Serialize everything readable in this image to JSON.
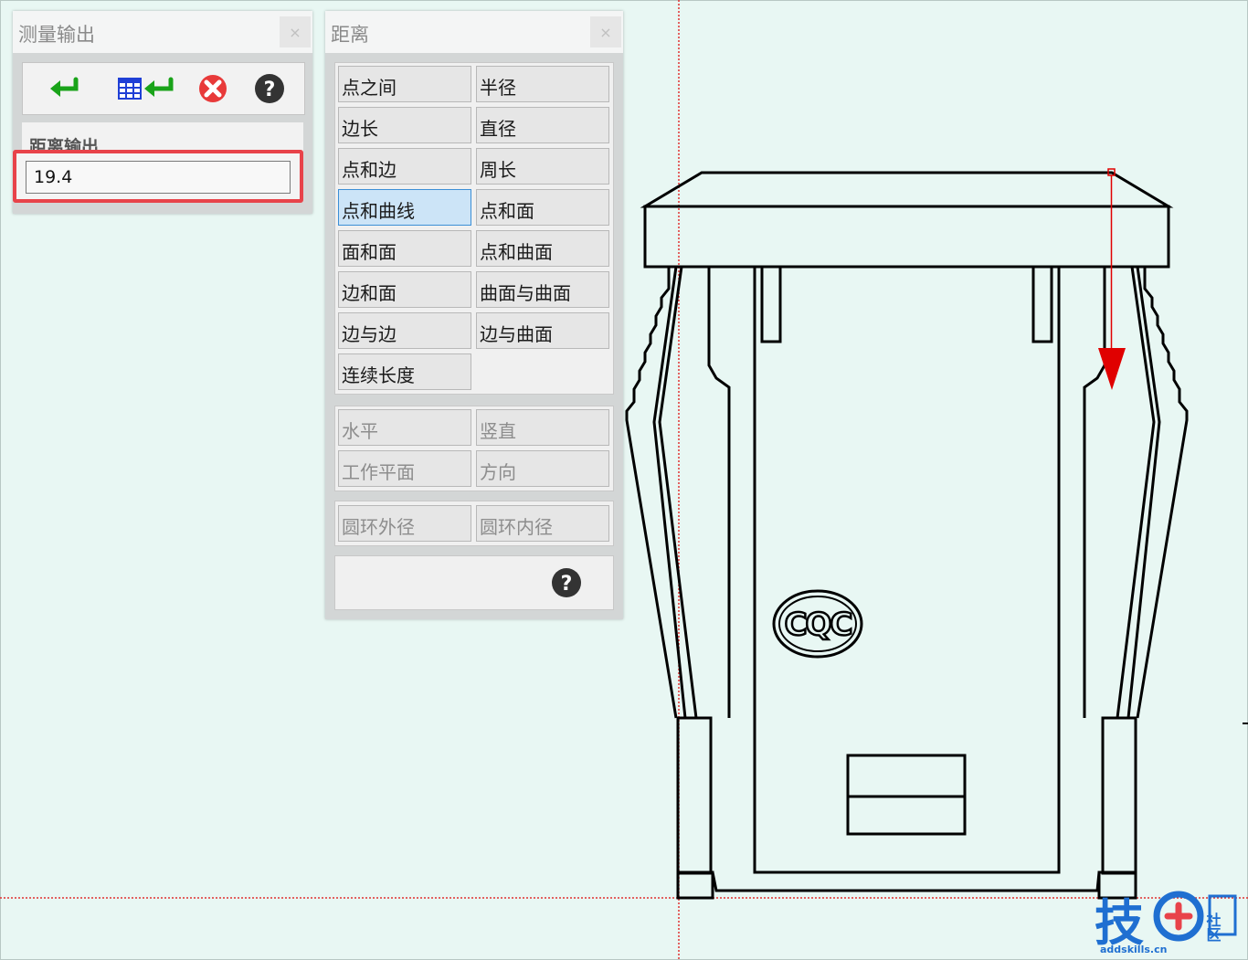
{
  "output_panel": {
    "title": "测量输出",
    "close": "×",
    "section_label": "距离输出",
    "value": "19.4"
  },
  "distance_panel": {
    "title": "距离",
    "close": "×",
    "modes": [
      [
        "点之间",
        "半径"
      ],
      [
        "边长",
        "直径"
      ],
      [
        "点和边",
        "周长"
      ],
      [
        "点和曲线",
        "点和面"
      ],
      [
        "面和面",
        "点和曲面"
      ],
      [
        "边和面",
        "曲面与曲面"
      ],
      [
        "边与边",
        "边与曲面"
      ],
      [
        "连续长度",
        ""
      ]
    ],
    "selected": "点和曲线",
    "constraints": [
      [
        "水平",
        "竖直"
      ],
      [
        "工作平面",
        "方向"
      ]
    ],
    "rings": [
      [
        "圆环外径",
        "圆环内径"
      ]
    ]
  },
  "drawing": {
    "badge_text": "CQC"
  },
  "watermark": {
    "main": "技",
    "side": "社区",
    "url": "addskills.cn"
  },
  "colors": {
    "accent_red": "#e8434a",
    "arrow_red": "#e00000",
    "selected_blue": "#cce4f7",
    "ok_green": "#19a319",
    "canvas_bg": "#e8f7f3"
  },
  "icons": [
    "ok-arrow-icon",
    "table-ok-icon",
    "cancel-icon",
    "help-icon"
  ]
}
